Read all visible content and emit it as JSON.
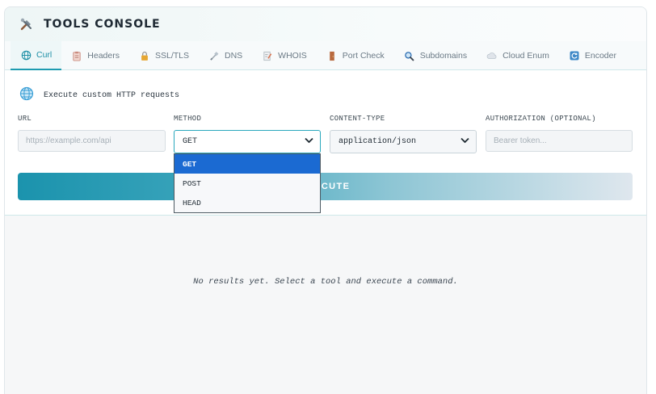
{
  "header": {
    "title": "TOOLS CONSOLE",
    "logo_icon": "tools-icon"
  },
  "tabs": [
    {
      "label": "Curl",
      "icon": "globe-icon",
      "active": true
    },
    {
      "label": "Headers",
      "icon": "clipboard-icon",
      "active": false
    },
    {
      "label": "SSL/TLS",
      "icon": "lock-icon",
      "active": false
    },
    {
      "label": "DNS",
      "icon": "satellite-icon",
      "active": false
    },
    {
      "label": "WHOIS",
      "icon": "memo-icon",
      "active": false
    },
    {
      "label": "Port Check",
      "icon": "door-icon",
      "active": false
    },
    {
      "label": "Subdomains",
      "icon": "magnifier-icon",
      "active": false
    },
    {
      "label": "Cloud Enum",
      "icon": "cloud-icon",
      "active": false
    },
    {
      "label": "Encoder",
      "icon": "refresh-icon",
      "active": false
    }
  ],
  "curl": {
    "description": "Execute custom HTTP requests",
    "url_label": "URL",
    "url_placeholder": "https://example.com/api",
    "method_label": "METHOD",
    "method_value": "GET",
    "content_type_label": "CONTENT-TYPE",
    "content_type_value": "application/json",
    "auth_label": "AUTHORIZATION (OPTIONAL)",
    "auth_placeholder": "Bearer token...",
    "execute_label": "EXECUTE"
  },
  "method_dropdown": {
    "options": [
      "GET",
      "POST",
      "HEAD"
    ],
    "selected": "GET"
  },
  "results": {
    "empty_text": "No results yet. Select a tool and execute a command."
  },
  "colors": {
    "accent": "#1d9bb0",
    "selected_option": "#1b6ad2"
  }
}
